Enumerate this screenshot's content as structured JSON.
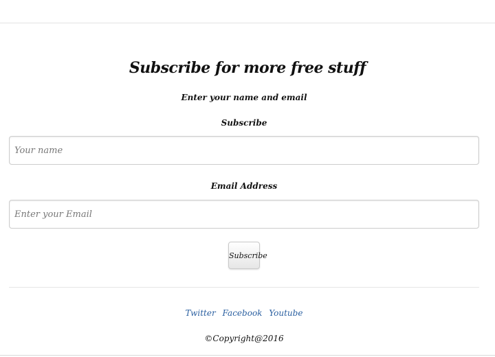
{
  "form": {
    "title": "Subscribe for more free stuff",
    "subtitle": "Enter your name and email",
    "name_label": "Subscribe",
    "name_placeholder": "Your name",
    "email_label": "Email Address",
    "email_placeholder": "Enter your Email",
    "submit_label": "Subscribe"
  },
  "footer": {
    "links": [
      "Twitter",
      "Facebook",
      "Youtube"
    ],
    "copyright": "©Copyright@2016"
  },
  "colors": {
    "link": "#2a5fa0",
    "text": "#111111",
    "border": "#cccccc"
  }
}
